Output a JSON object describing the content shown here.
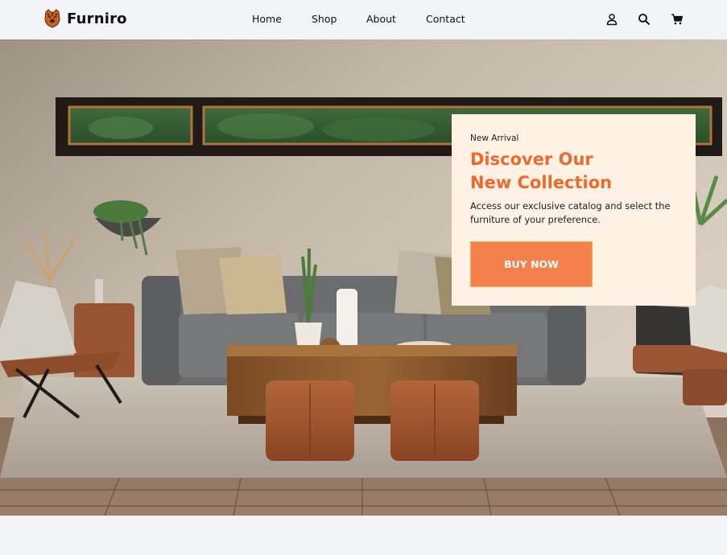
{
  "brand": {
    "name": "Furniro",
    "logo_icon": "tiger-head-icon"
  },
  "nav": {
    "items": [
      "Home",
      "Shop",
      "About",
      "Contact"
    ]
  },
  "header_icons": [
    "user-icon",
    "search-icon",
    "cart-icon"
  ],
  "hero": {
    "image": "living-room-sofa-photo",
    "eyebrow": "New Arrival",
    "headline_line1": "Discover Our",
    "headline_line2": "New Collection",
    "description": "Access our exclusive catalog and select the furniture of your preference.",
    "cta_label": "BUY NOW"
  },
  "colors": {
    "accent": "#ec6a2c",
    "button": "#f4804b",
    "card_bg": "#fff1e4",
    "header_bg": "#f3f4f7"
  }
}
